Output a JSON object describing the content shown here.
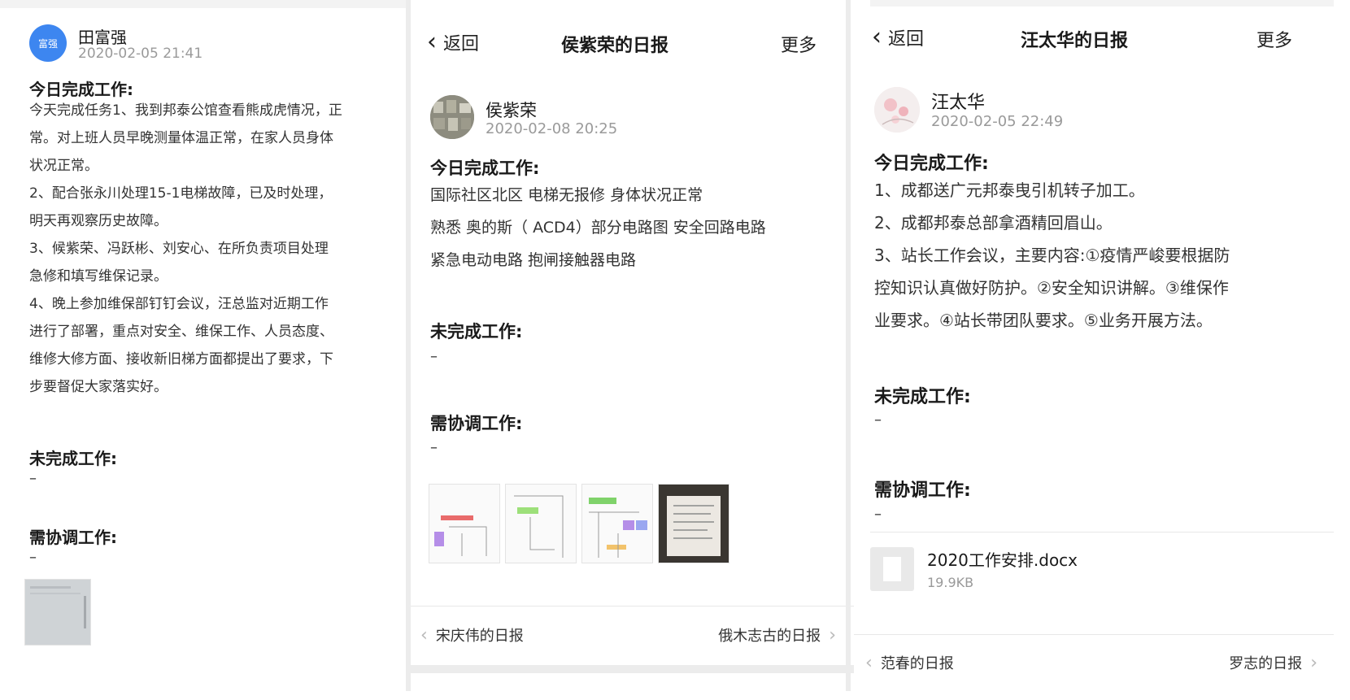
{
  "p1": {
    "avatar_text": "富强",
    "name": "田富强",
    "time": "2020-02-05 21:41",
    "done_title": "今日完成工作:",
    "done_lines": [
      "今天完成任务1、我到邦泰公馆查看熊成虎情况，正",
      "常。对上班人员早晚测量体温正常，在家人员身体",
      "状况正常。",
      "2、配合张永川处理15-1电梯故障，已及时处理，",
      "明天再观察历史故障。",
      "3、候紫荣、冯跃彬、刘安心、在所负责项目处理",
      "急修和填写维保记录。",
      "4、晚上参加维保部钉钉会议，汪总监对近期工作",
      "进行了部署，重点对安全、维保工作、人员态度、",
      "维修大修方面、接收新旧梯方面都提出了要求，下",
      "步要督促大家落实好。"
    ],
    "undone_title": "未完成工作:",
    "undone_value": "–",
    "coord_title": "需协调工作:",
    "coord_value": "–"
  },
  "p2": {
    "back": "返回",
    "title": "侯紫荣的日报",
    "more": "更多",
    "name": "侯紫荣",
    "time": "2020-02-08 20:25",
    "done_title": "今日完成工作:",
    "done_lines": [
      "国际社区北区 电梯无报修  身体状况正常",
      "熟悉 奥的斯（ ACD4）部分电路图  安全回路电路",
      "紧急电动电路   抱闸接触器电路"
    ],
    "undone_title": "未完成工作:",
    "undone_value": "–",
    "coord_title": "需协调工作:",
    "coord_value": "–",
    "prev": "宋庆伟的日报",
    "next": "俄木志古的日报"
  },
  "p3": {
    "back": "返回",
    "title": "汪太华的日报",
    "more": "更多",
    "name": "汪太华",
    "time": "2020-02-05 22:49",
    "done_title": "今日完成工作:",
    "done_lines": [
      "1、成都送广元邦泰曳引机转子加工。",
      "2、成都邦泰总部拿酒精回眉山。",
      "3、站长工作会议，主要内容:①疫情严峻要根据防",
      "控知识认真做好防护。②安全知识讲解。③维保作",
      "业要求。④站长带团队要求。⑤业务开展方法。"
    ],
    "undone_title": "未完成工作:",
    "undone_value": "–",
    "coord_title": "需协调工作:",
    "coord_value": "–",
    "file_name": "2020工作安排.docx",
    "file_size": "19.9KB",
    "prev": "范春的日报",
    "next": "罗志的日报"
  },
  "colors": {
    "avatar_blue": "#3d86f0",
    "muted": "#9a9a9a",
    "divider": "#ececec"
  },
  "icons": [
    "back-chevron-icon",
    "prev-chevron-icon",
    "next-chevron-icon",
    "file-icon"
  ]
}
